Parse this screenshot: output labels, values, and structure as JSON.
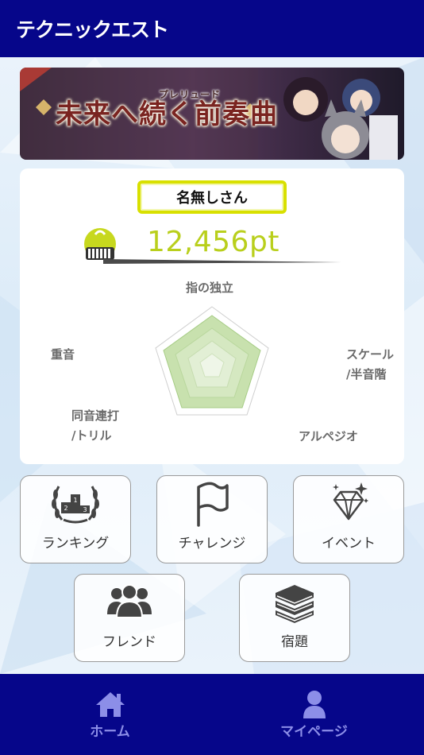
{
  "header": {
    "title": "テクニックエスト"
  },
  "banner": {
    "title": "未来へ続く前奏曲",
    "ruby": "プレリュード"
  },
  "profile": {
    "name": "名無しさん",
    "score": "12,456pt"
  },
  "radar": {
    "axes": {
      "top": "指の独立",
      "right": "スケール\n/半音階",
      "bottom_right": "アルペジオ",
      "bottom_left": "同音連打\n/トリル",
      "left": "重音"
    }
  },
  "menu": {
    "ranking": "ランキング",
    "challenge": "チャレンジ",
    "event": "イベント",
    "friend": "フレンド",
    "homework": "宿題"
  },
  "tabs": {
    "home": "ホーム",
    "mypage": "マイページ"
  },
  "colors": {
    "nav": "#06068a",
    "accent_yellow": "#d8e000",
    "score_green": "#b9cf1c",
    "tab_text": "#8c8ee8"
  }
}
